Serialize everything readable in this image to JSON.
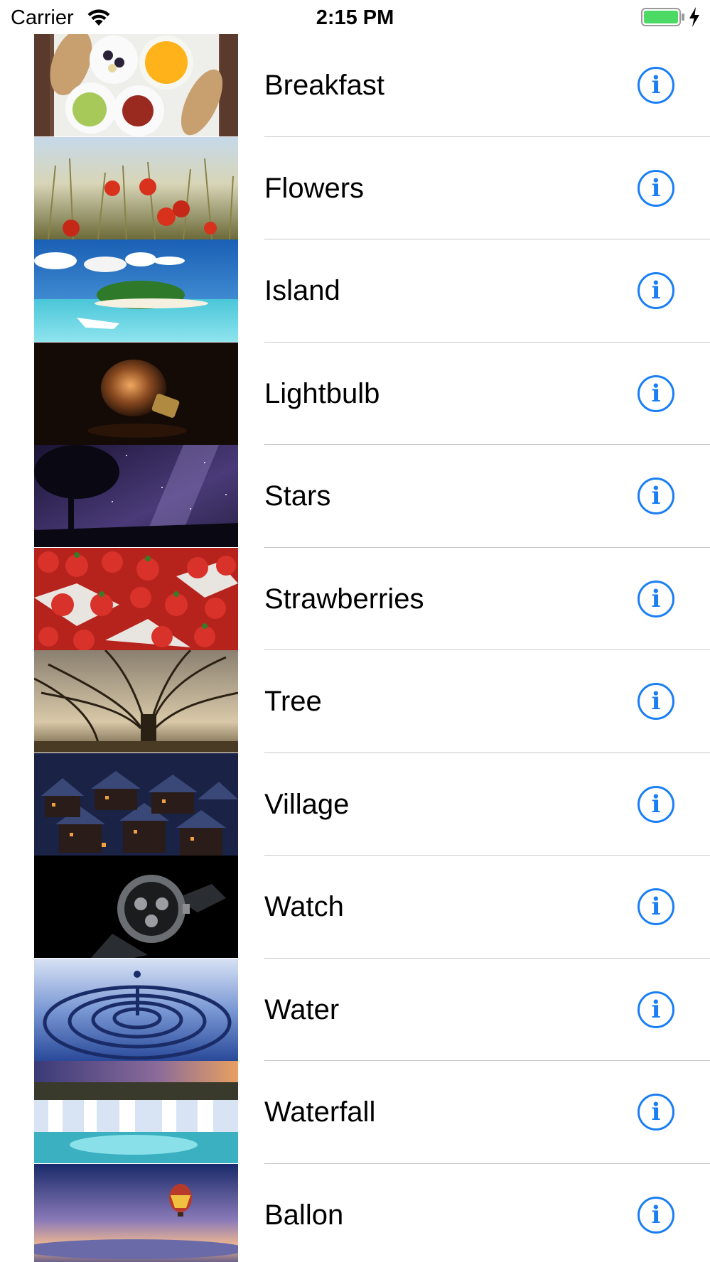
{
  "status_bar": {
    "carrier": "Carrier",
    "time": "2:15 PM",
    "wifi_icon": "wifi-icon",
    "battery_icon": "battery-full-icon",
    "charging_icon": "charging-bolt-icon",
    "battery_color": "#4cd964"
  },
  "accent_color": "#1a7ef5",
  "info_glyph": "i",
  "rows": [
    {
      "label": "Breakfast",
      "icon": "info-icon",
      "image": "breakfast-photo"
    },
    {
      "label": "Flowers",
      "icon": "info-icon",
      "image": "flowers-photo"
    },
    {
      "label": "Island",
      "icon": "info-icon",
      "image": "island-photo"
    },
    {
      "label": "Lightbulb",
      "icon": "info-icon",
      "image": "lightbulb-photo"
    },
    {
      "label": "Stars",
      "icon": "info-icon",
      "image": "stars-photo"
    },
    {
      "label": "Strawberries",
      "icon": "info-icon",
      "image": "strawberries-photo"
    },
    {
      "label": "Tree",
      "icon": "info-icon",
      "image": "tree-photo"
    },
    {
      "label": "Village",
      "icon": "info-icon",
      "image": "village-photo"
    },
    {
      "label": "Watch",
      "icon": "info-icon",
      "image": "watch-photo"
    },
    {
      "label": "Water",
      "icon": "info-icon",
      "image": "water-photo"
    },
    {
      "label": "Waterfall",
      "icon": "info-icon",
      "image": "waterfall-photo"
    },
    {
      "label": "Ballon",
      "icon": "info-icon",
      "image": "ballon-photo"
    }
  ]
}
